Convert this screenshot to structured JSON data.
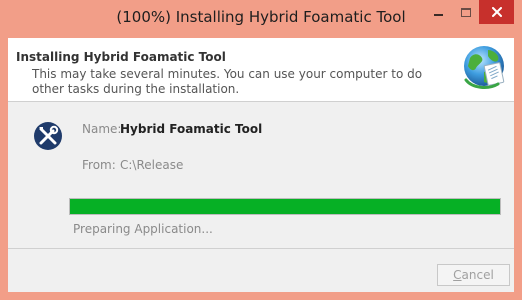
{
  "window": {
    "title": "(100%) Installing Hybrid Foamatic Tool",
    "controls": [
      "minimize-icon",
      "maximize-icon",
      "close-icon"
    ]
  },
  "header": {
    "title": "Installing Hybrid Foamatic Tool",
    "description": "This may take several minutes. You can use your computer to do other tasks during the installation.",
    "icon": "globe-install-icon"
  },
  "app": {
    "icon": "tools-icon",
    "name_label": "Name:",
    "name_value": "Hybrid Foamatic Tool",
    "from_label": "From:",
    "from_value": "C:\\Release"
  },
  "progress": {
    "value": 1.0,
    "status": "Preparing Application..."
  },
  "footer": {
    "cancel_accel": "C",
    "cancel_rest": "ancel"
  },
  "colors": {
    "titlebar": "#f29e88",
    "close_button": "#c7302c",
    "progress_fill": "#06b025",
    "app_icon_bg": "#1f3b6b"
  }
}
